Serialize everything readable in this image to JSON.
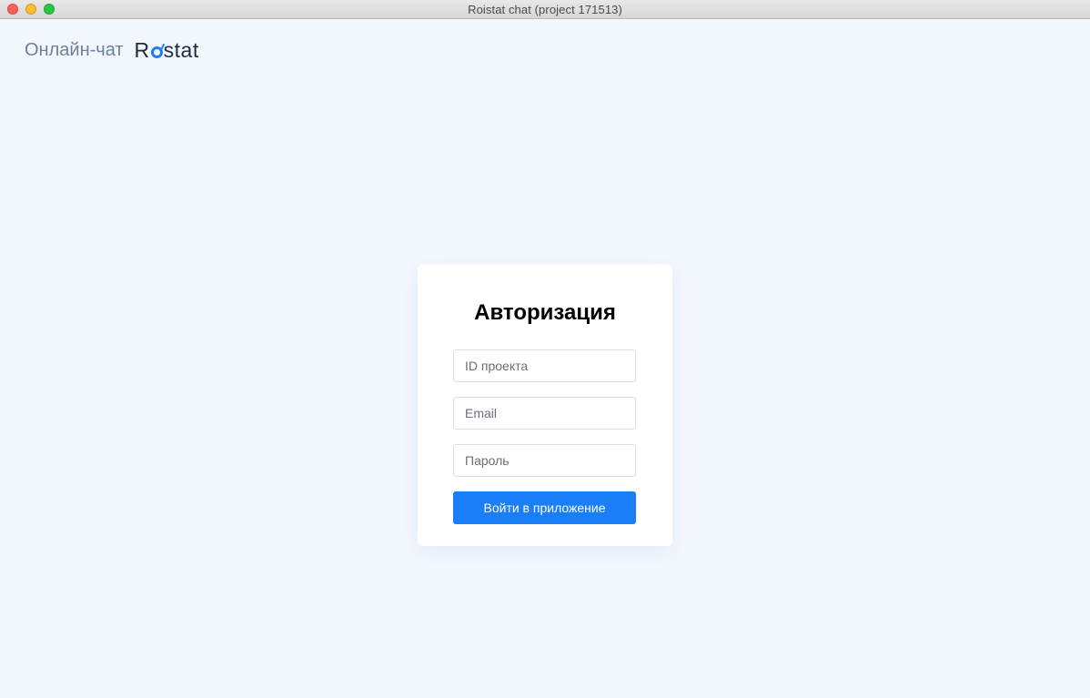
{
  "window": {
    "title": "Roistat chat (project 171513)"
  },
  "header": {
    "product_label": "Онлайн-чат",
    "brand_prefix": "R",
    "brand_suffix": "stat",
    "brand_accent_color": "#1f7cf5"
  },
  "auth": {
    "title": "Авторизация",
    "project_id": {
      "placeholder": "ID проекта",
      "value": ""
    },
    "email": {
      "placeholder": "Email",
      "value": ""
    },
    "password": {
      "placeholder": "Пароль",
      "value": ""
    },
    "submit_label": "Войти в приложение",
    "submit_color": "#1a7ef8"
  }
}
